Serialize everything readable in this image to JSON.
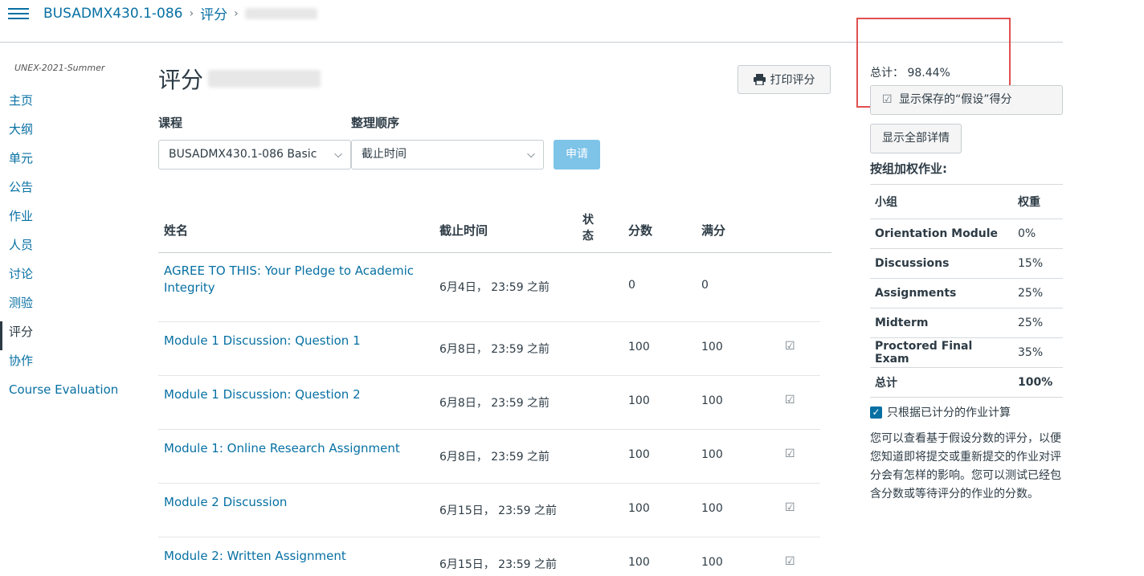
{
  "breadcrumb": {
    "course": "BUSADMX430.1-086",
    "grades": "评分"
  },
  "term": "UNEX-2021-Summer",
  "nav": [
    "主页",
    "大纲",
    "单元",
    "公告",
    "作业",
    "人员",
    "讨论",
    "测验",
    "评分",
    "协作",
    "Course Evaluation"
  ],
  "page_title": "评分",
  "print_label": "打印评分",
  "filters": {
    "course_label": "课程",
    "course_value": "BUSADMX430.1-086 Basic",
    "sort_label": "整理顺序",
    "sort_value": "截止时间",
    "apply_label": "申请"
  },
  "table": {
    "headers": {
      "name": "姓名",
      "due": "截止时间",
      "status": "状态",
      "score": "分数",
      "total": "满分"
    },
    "rows": [
      {
        "name": "AGREE TO THIS: Your Pledge to Academic Integrity",
        "due": "6月4日， 23:59 之前",
        "score": "0",
        "total": "0"
      },
      {
        "name": "Module 1 Discussion: Question 1",
        "due": "6月8日， 23:59 之前",
        "score": "100",
        "total": "100"
      },
      {
        "name": "Module 1 Discussion: Question 2",
        "due": "6月8日， 23:59 之前",
        "score": "100",
        "total": "100"
      },
      {
        "name": "Module 1: Online Research Assignment",
        "due": "6月8日， 23:59 之前",
        "score": "100",
        "total": "100"
      },
      {
        "name": "Module 2 Discussion",
        "due": "6月15日， 23:59 之前",
        "score": "100",
        "total": "100"
      },
      {
        "name": "Module 2: Written Assignment",
        "due": "6月15日， 23:59 之前",
        "score": "100",
        "total": "100"
      }
    ]
  },
  "sidebar": {
    "total_label": "总计：",
    "total_value": "98.44%",
    "show_whatif": "显示保存的“假设”得分",
    "show_all": "显示全部详情",
    "weights_title": "按组加权作业:",
    "weights_header": {
      "group": "小组",
      "weight": "权重"
    },
    "weights": [
      {
        "group": "Orientation Module",
        "weight": "0%"
      },
      {
        "group": "Discussions",
        "weight": "15%"
      },
      {
        "group": "Assignments",
        "weight": "25%"
      },
      {
        "group": "Midterm",
        "weight": "25%"
      },
      {
        "group": "Proctored Final Exam",
        "weight": "35%"
      }
    ],
    "weights_total": {
      "group": "总计",
      "weight": "100%"
    },
    "only_graded": "只根据已计分的作业计算",
    "whatif_text": "您可以查看基于假设分数的评分，以便您知道即将提交或重新提交的作业对评分会有怎样的影响。您可以测试已经包含分数或等待评分的作业的分数。"
  },
  "colors": {
    "link": "#0770a3",
    "apply": "#7ec3e8",
    "highlight_box": "#e05050"
  }
}
